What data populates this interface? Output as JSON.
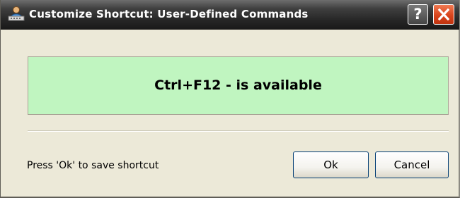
{
  "window": {
    "title": "Customize Shortcut: User-Defined Commands",
    "app_icon": "user-commands-icon",
    "help_label": "?",
    "close_icon": "close-icon"
  },
  "status": {
    "message": "Ctrl+F12 - is available",
    "background_color": "#c0f5c0"
  },
  "footer": {
    "hint": "Press 'Ok' to save shortcut",
    "ok_label": "Ok",
    "cancel_label": "Cancel"
  },
  "colors": {
    "titlebar": "#262626",
    "close_button": "#d9441c",
    "dialog_background": "#ece9d8"
  }
}
